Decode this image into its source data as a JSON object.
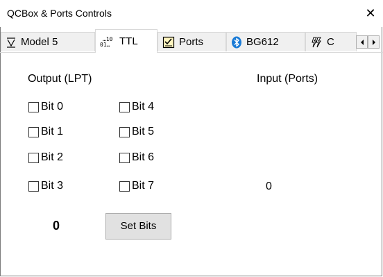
{
  "window": {
    "title": "QCBox & Ports Controls"
  },
  "tabs": [
    {
      "label": "Model 5",
      "icon": "model-v-icon"
    },
    {
      "label": "TTL",
      "icon": "binary-icon"
    },
    {
      "label": "Ports",
      "icon": "ports-checklist-icon"
    },
    {
      "label": "BG612",
      "icon": "bluetooth-icon"
    },
    {
      "label": "C",
      "icon": "lightning-icon"
    }
  ],
  "output": {
    "heading": "Output (LPT)",
    "bits": [
      "Bit 0",
      "Bit 1",
      "Bit 2",
      "Bit 3",
      "Bit 4",
      "Bit 5",
      "Bit 6",
      "Bit 7"
    ],
    "value": "0",
    "set_button": "Set Bits"
  },
  "input": {
    "heading": "Input (Ports)",
    "value": "0"
  }
}
